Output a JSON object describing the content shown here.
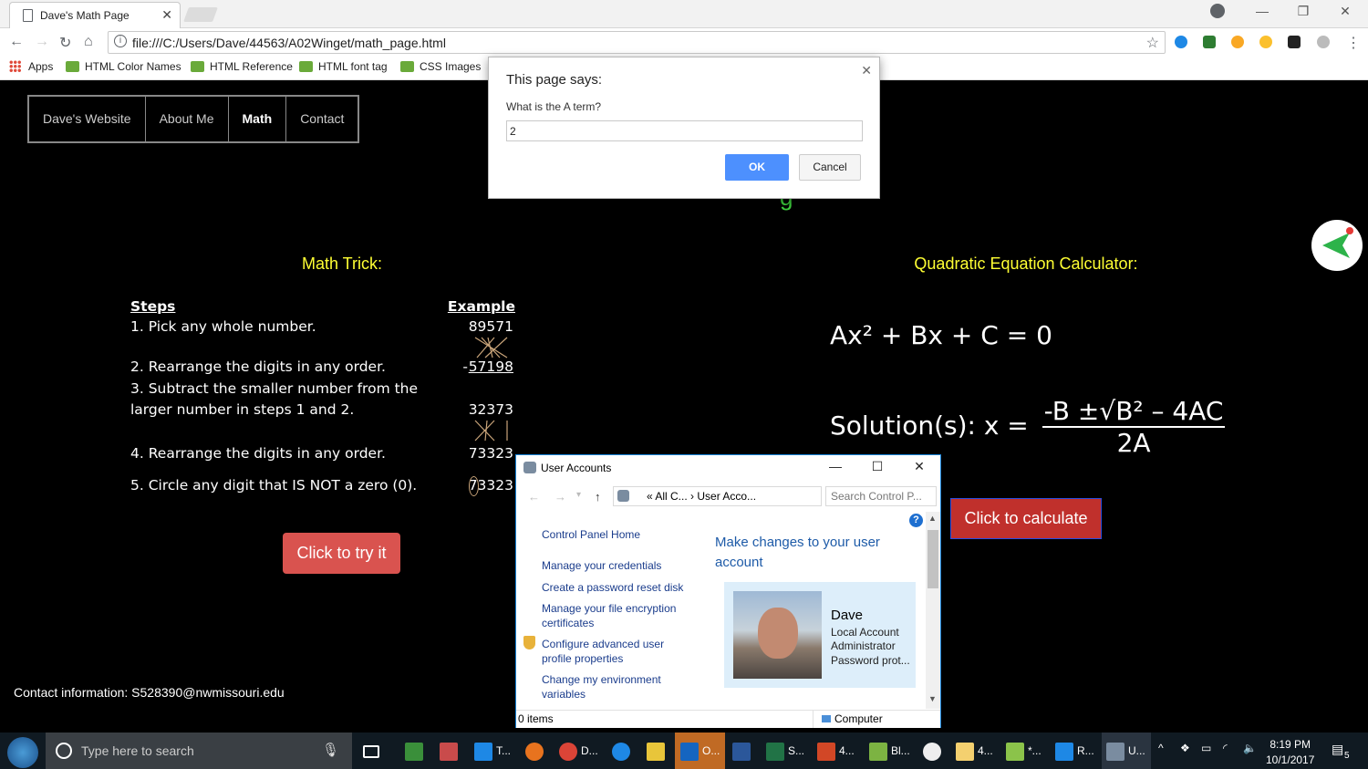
{
  "browser": {
    "tab_title": "Dave's Math Page",
    "url": "file:///C:/Users/Dave/44563/A02Winget/math_page.html",
    "bookmarks": [
      "Apps",
      "HTML Color Names",
      "HTML Reference",
      "HTML font tag",
      "CSS Images"
    ]
  },
  "page": {
    "nav": [
      "Dave's Website",
      "About Me",
      "Math",
      "Contact"
    ],
    "heading_fragment": "g",
    "math_trick_title": "Math Trick:",
    "quad_title": "Quadratic Equation Calculator:",
    "steps_header": "Steps",
    "example_header": "Example",
    "steps": [
      "1. Pick any whole number.",
      "2. Rearrange the digits in any order.",
      "3. Subtract the smaller number from the",
      "larger number in steps 1 and 2.",
      "4. Rearrange the digits in any order.",
      "5. Circle any digit that IS NOT a zero (0)."
    ],
    "example": {
      "n1": "89571",
      "minus": "-",
      "n2": "57198",
      "n3": "32373",
      "n4": "73323",
      "n5": "73323"
    },
    "try_button": "Click to try it",
    "calc_button": "Click to calculate",
    "formula": "Ax² + Bx + C = 0",
    "solution_prefix": "Solution(s): x =",
    "solution_numerator": "-B ±√B² – 4AC",
    "solution_denominator": "2A",
    "contact": "Contact information: S528390@nwmissouri.edu"
  },
  "prompt": {
    "title": "This page says:",
    "message": "What is the A term?",
    "value": "2",
    "ok": "OK",
    "cancel": "Cancel"
  },
  "user_accounts": {
    "title": "User Accounts",
    "breadcrumb": "« All C...  ›  User Acco...",
    "search_placeholder": "Search Control P...",
    "left_links": [
      "Control Panel Home",
      "Manage your credentials",
      "Create a password reset disk",
      "Manage your file encryption certificates",
      "Configure advanced user profile properties",
      "Change my environment variables"
    ],
    "main_title": "Make changes to your user account",
    "user_name": "Dave",
    "user_info": [
      "Local Account",
      "Administrator",
      "Password prot..."
    ],
    "status_items": "0 items",
    "status_location": "Computer"
  },
  "taskbar": {
    "search_placeholder": "Type here to search",
    "apps": [
      "T...",
      "D...",
      "O...",
      "S...",
      "4...",
      "Bl...",
      "4...",
      "*...",
      "R...",
      "U..."
    ],
    "time": "8:19 PM",
    "date": "10/1/2017",
    "notifications": "5"
  },
  "colors": {
    "yellow": "#ffff33",
    "green": "#3ecf3e",
    "try_button": "#d9534f",
    "calc_button": "#c0302c",
    "prompt_ok": "#4d90fe"
  }
}
